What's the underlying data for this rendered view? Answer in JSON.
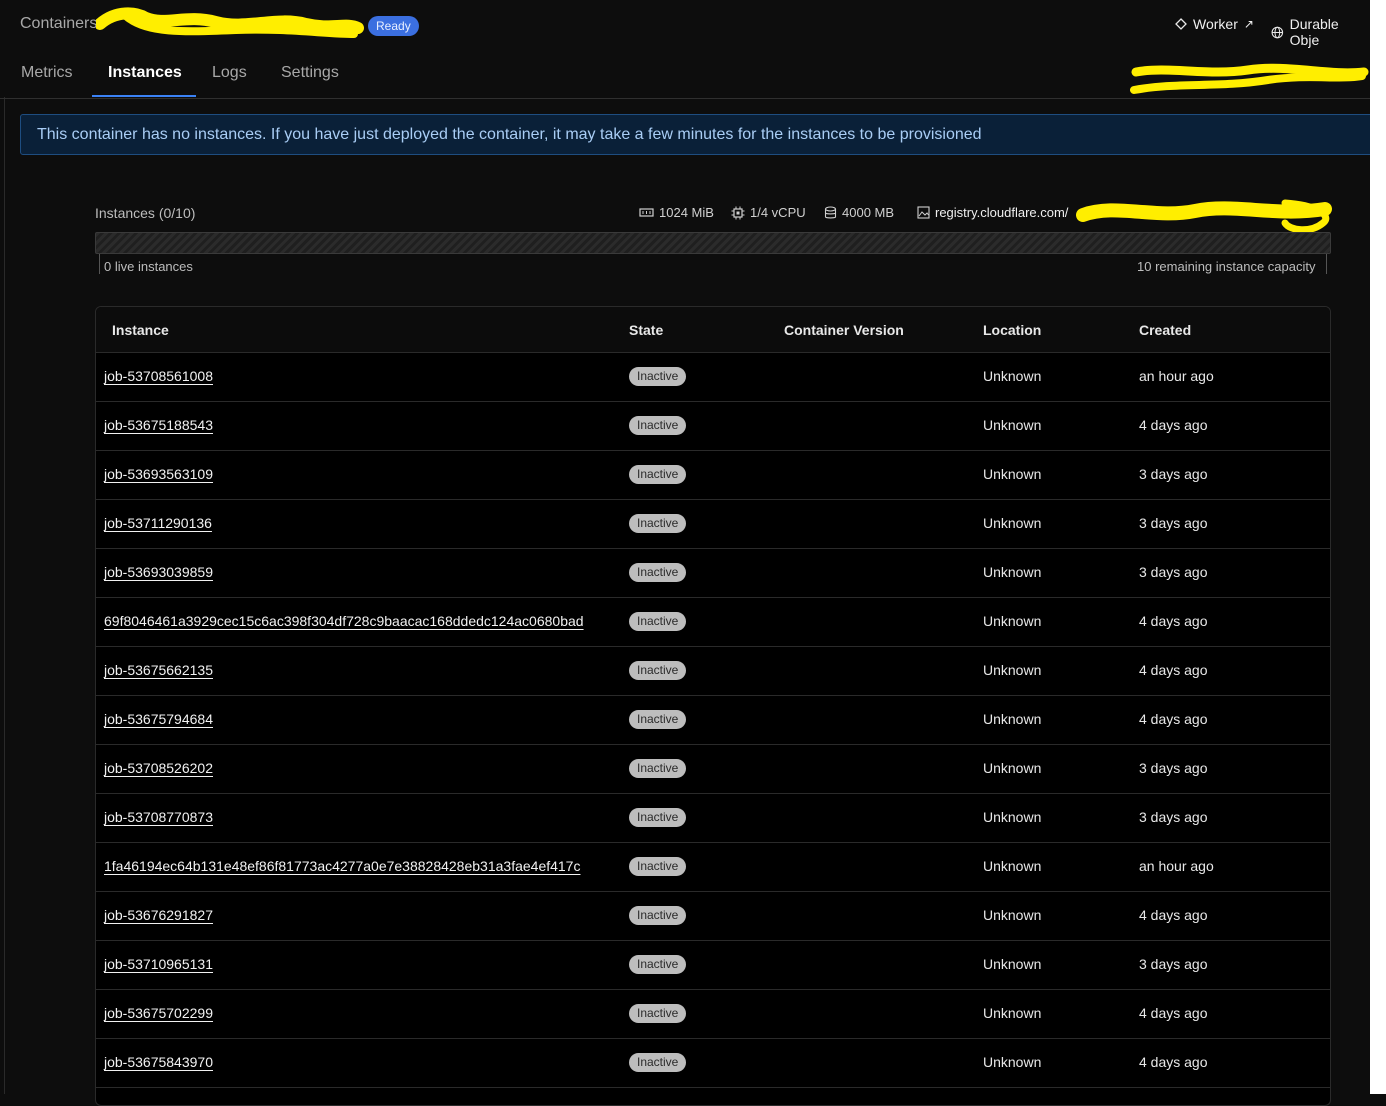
{
  "header": {
    "breadcrumb": "Containers",
    "status": "Ready",
    "links": [
      {
        "label": "Worker",
        "icon": "diamond-icon",
        "suffix": "↗"
      },
      {
        "label": "Durable Obje",
        "icon": "globe-icon"
      }
    ]
  },
  "tabs": [
    {
      "label": "Metrics",
      "active": false
    },
    {
      "label": "Instances",
      "active": true
    },
    {
      "label": "Logs",
      "active": false
    },
    {
      "label": "Settings",
      "active": false
    }
  ],
  "notice": "This container has no instances. If you have just deployed the container, it may take a few minutes for the instances to be provisioned",
  "summary": {
    "title": "Instances (0/10)",
    "memory": "1024 MiB",
    "vcpu": "1/4 vCPU",
    "disk": "4000 MB",
    "image": "registry.cloudflare.com/",
    "live_label": "0 live instances",
    "remaining_label": "10 remaining instance capacity",
    "live_count": 0,
    "capacity": 10
  },
  "table": {
    "headers": [
      "Instance",
      "State",
      "Container Version",
      "Location",
      "Created"
    ],
    "rows": [
      {
        "id": "job-53708561008",
        "state": "Inactive",
        "version": "",
        "location": "Unknown",
        "created": "an hour ago"
      },
      {
        "id": "job-53675188543",
        "state": "Inactive",
        "version": "",
        "location": "Unknown",
        "created": "4 days ago"
      },
      {
        "id": "job-53693563109",
        "state": "Inactive",
        "version": "",
        "location": "Unknown",
        "created": "3 days ago"
      },
      {
        "id": "job-53711290136",
        "state": "Inactive",
        "version": "",
        "location": "Unknown",
        "created": "3 days ago"
      },
      {
        "id": "job-53693039859",
        "state": "Inactive",
        "version": "",
        "location": "Unknown",
        "created": "3 days ago"
      },
      {
        "id": "69f8046461a3929cec15c6ac398f304df728c9baacac168ddedc124ac0680bad",
        "state": "Inactive",
        "version": "",
        "location": "Unknown",
        "created": "4 days ago"
      },
      {
        "id": "job-53675662135",
        "state": "Inactive",
        "version": "",
        "location": "Unknown",
        "created": "4 days ago"
      },
      {
        "id": "job-53675794684",
        "state": "Inactive",
        "version": "",
        "location": "Unknown",
        "created": "4 days ago"
      },
      {
        "id": "job-53708526202",
        "state": "Inactive",
        "version": "",
        "location": "Unknown",
        "created": "3 days ago"
      },
      {
        "id": "job-53708770873",
        "state": "Inactive",
        "version": "",
        "location": "Unknown",
        "created": "3 days ago"
      },
      {
        "id": "1fa46194ec64b131e48ef86f81773ac4277a0e7e38828428eb31a3fae4ef417c",
        "state": "Inactive",
        "version": "",
        "location": "Unknown",
        "created": "an hour ago"
      },
      {
        "id": "job-53676291827",
        "state": "Inactive",
        "version": "",
        "location": "Unknown",
        "created": "4 days ago"
      },
      {
        "id": "job-53710965131",
        "state": "Inactive",
        "version": "",
        "location": "Unknown",
        "created": "3 days ago"
      },
      {
        "id": "job-53675702299",
        "state": "Inactive",
        "version": "",
        "location": "Unknown",
        "created": "4 days ago"
      },
      {
        "id": "job-53675843970",
        "state": "Inactive",
        "version": "",
        "location": "Unknown",
        "created": "4 days ago"
      }
    ]
  },
  "colors": {
    "background": "#0d0d0d",
    "accent": "#3b82f6",
    "notice_bg": "#0a2038",
    "redaction": "#ffee00"
  }
}
